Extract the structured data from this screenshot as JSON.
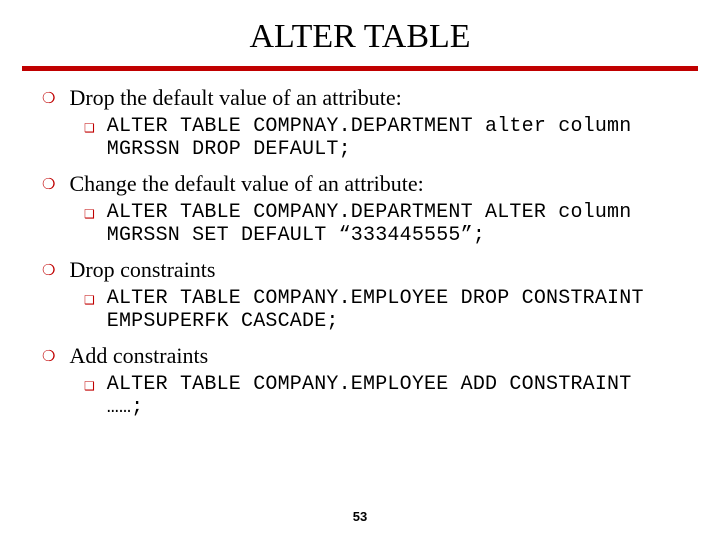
{
  "slide": {
    "title": "ALTER TABLE",
    "page_number": "53",
    "bullets": {
      "circle": "❍",
      "square": "❑"
    },
    "items": [
      {
        "heading": "Drop the default value of an attribute:",
        "code": "ALTER TABLE COMPNAY.DEPARTMENT alter column MGRSSN DROP DEFAULT;"
      },
      {
        "heading": "Change the default value of an attribute:",
        "code": "ALTER TABLE COMPANY.DEPARTMENT ALTER column MGRSSN SET DEFAULT “333445555”;"
      },
      {
        "heading": "Drop constraints",
        "code": "ALTER TABLE COMPANY.EMPLOYEE DROP CONSTRAINT EMPSUPERFK CASCADE;"
      },
      {
        "heading": "Add constraints",
        "code": "ALTER TABLE COMPANY.EMPLOYEE ADD CONSTRAINT ……;"
      }
    ]
  }
}
